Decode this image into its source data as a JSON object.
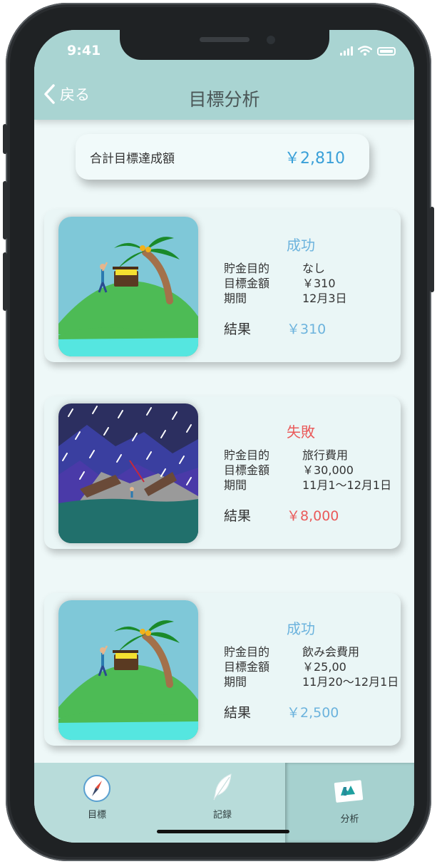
{
  "status_bar": {
    "time": "9:41"
  },
  "nav": {
    "back_label": "戻る",
    "title": "目標分析"
  },
  "summary": {
    "label": "合計目標達成額",
    "value": "￥2,810"
  },
  "cards": [
    {
      "status": "成功",
      "status_type": "success",
      "rows": [
        {
          "key": "貯金目的",
          "value": "なし"
        },
        {
          "key": "目標金額",
          "value": "￥310"
        },
        {
          "key": "期間",
          "value": "12月3日"
        }
      ],
      "result_label": "結果",
      "result_value": "￥310",
      "image": "island-treasure"
    },
    {
      "status": "失敗",
      "status_type": "failure",
      "rows": [
        {
          "key": "貯金目的",
          "value": "旅行費用"
        },
        {
          "key": "目標金額",
          "value": "￥30,000"
        },
        {
          "key": "期間",
          "value": "11月1〜12月1日"
        }
      ],
      "result_label": "結果",
      "result_value": "￥8,000",
      "image": "shipwreck-storm"
    },
    {
      "status": "成功",
      "status_type": "success",
      "rows": [
        {
          "key": "貯金目的",
          "value": "飲み会費用"
        },
        {
          "key": "目標金額",
          "value": "￥25,00"
        },
        {
          "key": "期間",
          "value": "11月20〜12月1日"
        }
      ],
      "result_label": "結果",
      "result_value": "￥2,500",
      "image": "island-treasure"
    }
  ],
  "tabs": [
    {
      "label": "目標",
      "icon": "compass-icon"
    },
    {
      "label": "記録",
      "icon": "feather-icon"
    },
    {
      "label": "分析",
      "icon": "chart-card-icon",
      "active": true
    }
  ],
  "colors": {
    "nav_bg": "#a9d4d2",
    "screen_bg": "#eef8f8",
    "success": "#6cb3dd",
    "failure": "#ea5a5a",
    "total_value": "#3aa0d8"
  }
}
